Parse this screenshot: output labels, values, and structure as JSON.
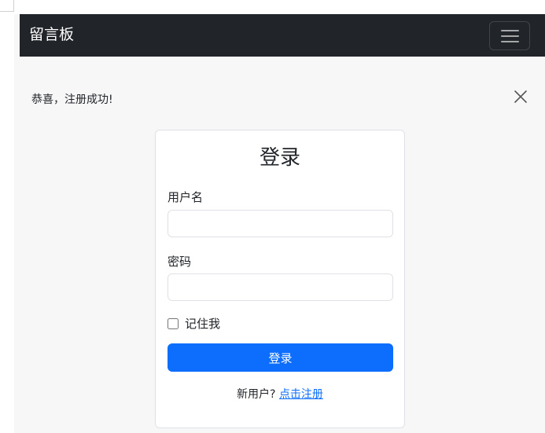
{
  "navbar": {
    "brand": "留言板",
    "toggler_icon": "hamburger-menu-icon"
  },
  "alert": {
    "message": "恭喜，注册成功!",
    "close_icon": "close-icon"
  },
  "login_card": {
    "title": "登录",
    "username_label": "用户名",
    "username_value": "",
    "password_label": "密码",
    "password_value": "",
    "remember_label": "记住我",
    "remember_checked": false,
    "submit_label": "登录",
    "register_prompt": "新用户? ",
    "register_link": "点击注册"
  },
  "colors": {
    "navbar_bg": "#212529",
    "primary": "#0d6efd",
    "page_bg": "#f7f7f7"
  }
}
